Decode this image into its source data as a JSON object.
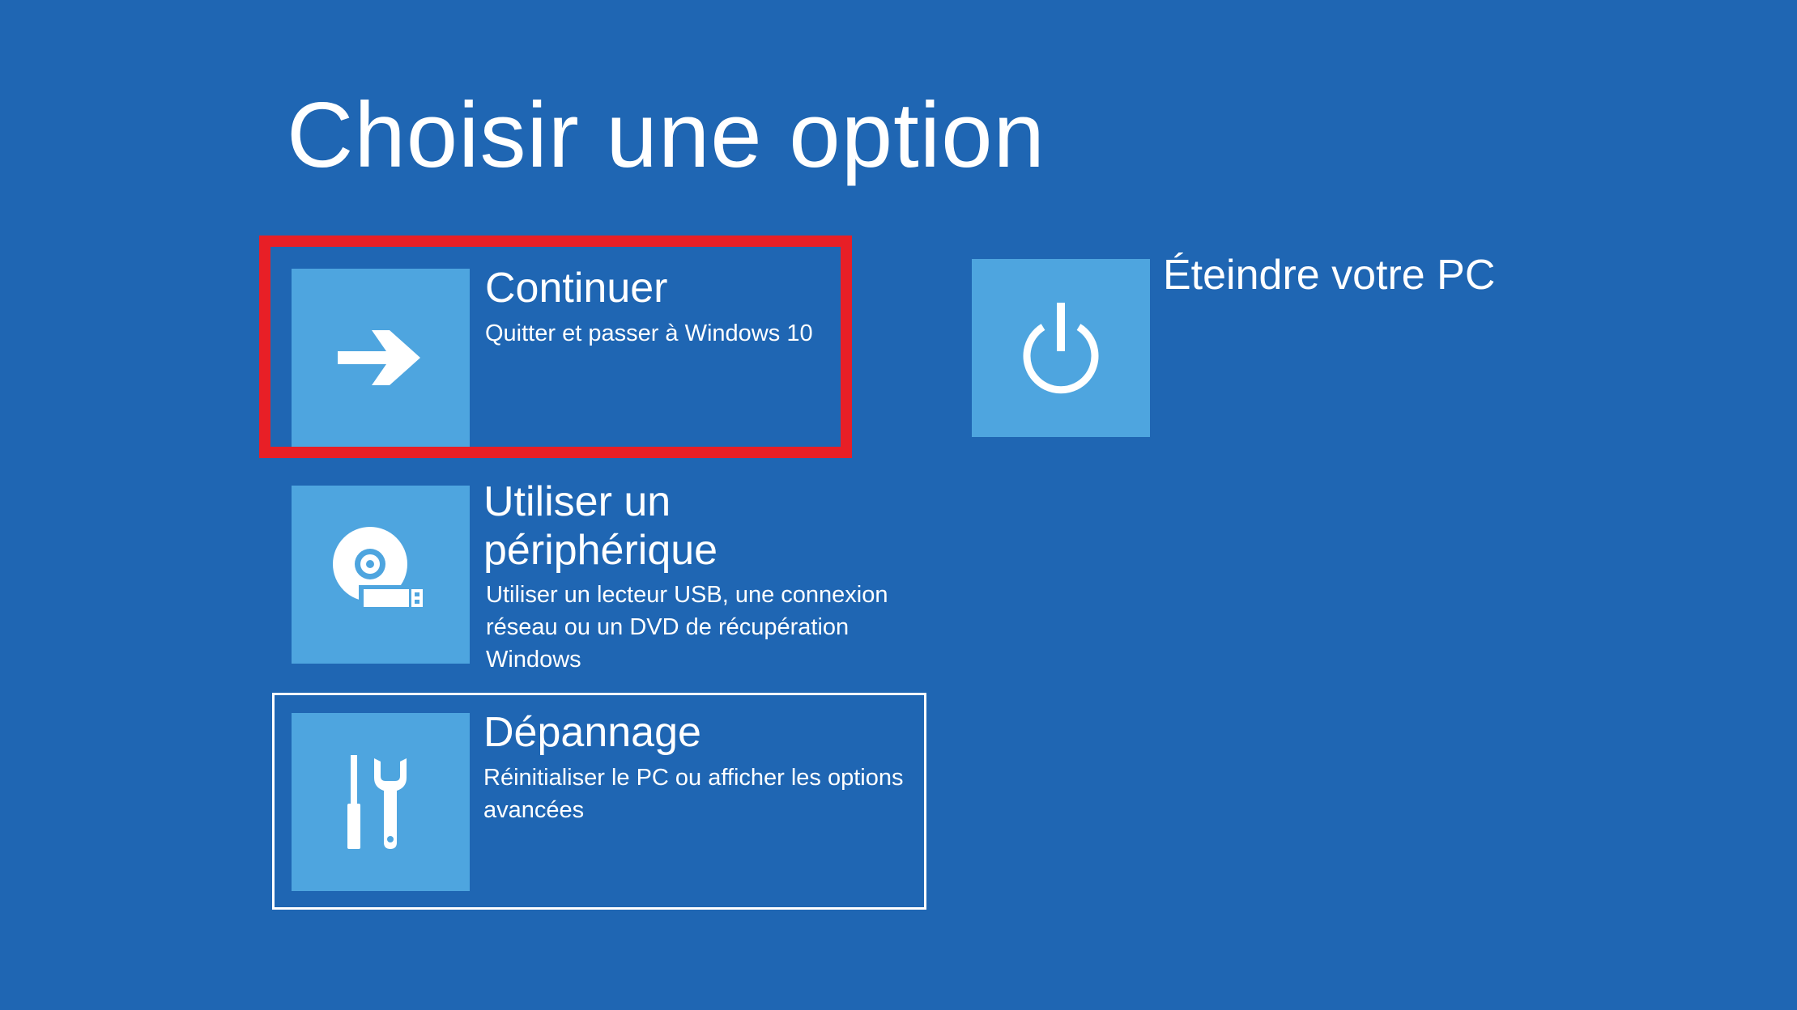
{
  "page": {
    "title": "Choisir une option",
    "background_color": "#1f66b3",
    "tile_color": "#4ea5df",
    "highlight_color": "#e81f26"
  },
  "options": {
    "continue": {
      "icon": "arrow-right-icon",
      "title": "Continuer",
      "description": "Quitter et passer à Windows 10"
    },
    "device": {
      "icon": "disc-usb-icon",
      "title": "Utiliser un périphérique",
      "description": "Utiliser un lecteur USB, une connexion réseau ou un DVD de récupération Windows"
    },
    "troubleshoot": {
      "icon": "tools-icon",
      "title": "Dépannage",
      "description": "Réinitialiser le PC ou afficher les options avancées"
    },
    "shutdown": {
      "icon": "power-icon",
      "title": "Éteindre votre PC"
    }
  }
}
